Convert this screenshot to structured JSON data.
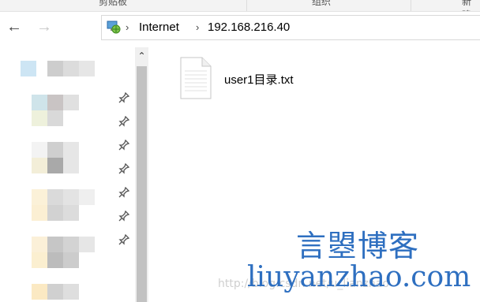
{
  "ribbon": {
    "groups": [
      "剪贴板",
      "组织",
      "新建"
    ]
  },
  "nav": {
    "back_icon": "arrow-left",
    "forward_icon": "arrow-right",
    "breadcrumbs": [
      "Internet",
      "192.168.216.40"
    ]
  },
  "file": {
    "name": "user1目录.txt",
    "icon": "text-file-icon"
  },
  "watermark": {
    "title": "言曌博客",
    "site": "liuyanzhao.com",
    "url_faint": "http://blog.csdn.net/u_lianzhao"
  },
  "colors": {
    "watermark": "#2e6fc0",
    "scroll_thumb": "#c2c2c2"
  }
}
